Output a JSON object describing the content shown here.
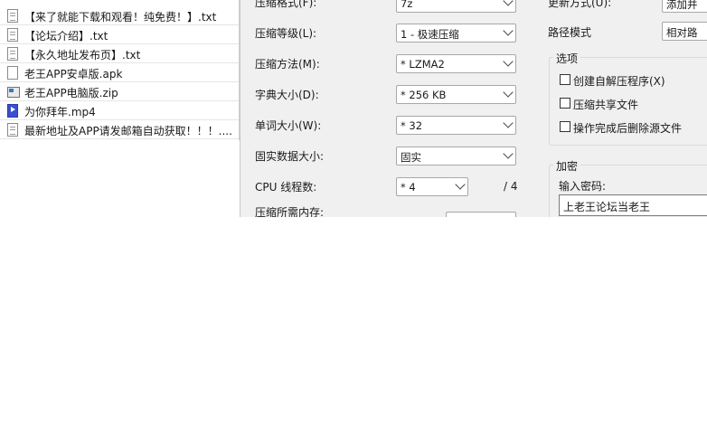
{
  "file_list": [
    {
      "icon": "text-file-icon",
      "name": "【来了就能下载和观看！纯免费！】.txt"
    },
    {
      "icon": "text-file-icon",
      "name": "【论坛介绍】.txt"
    },
    {
      "icon": "text-file-icon",
      "name": "【永久地址发布页】.txt"
    },
    {
      "icon": "file-icon",
      "name": "老王APP安卓版.apk"
    },
    {
      "icon": "archive-file-icon",
      "name": "老王APP电脑版.zip"
    },
    {
      "icon": "video-file-icon",
      "name": "为你拜年.mp4"
    },
    {
      "icon": "text-file-icon",
      "name": "最新地址及APP请发邮箱自动获取！！！...."
    }
  ],
  "dialog": {
    "format_label": "压缩格式(F):",
    "format_value": "7z",
    "level_label": "压缩等级(L):",
    "level_value": "1 - 极速压缩",
    "method_label": "压缩方法(M):",
    "method_value": "* LZMA2",
    "dict_label": "字典大小(D):",
    "dict_value": "* 256 KB",
    "word_label": "单词大小(W):",
    "word_value": "* 32",
    "solid_label": "固实数据大小:",
    "solid_value": "固实",
    "threads_label": "CPU 线程数:",
    "threads_value": "* 4",
    "threads_total": "/ 4",
    "memory_label": "压缩所需内存:",
    "update_label": "更新方式(U):",
    "update_value": "添加并",
    "path_label": "路径模式",
    "path_value": "相对路",
    "options_title": "选项",
    "options": [
      {
        "label": "创建自解压程序(X)",
        "checked": false
      },
      {
        "label": "压缩共享文件",
        "checked": false
      },
      {
        "label": "操作完成后删除源文件",
        "checked": false
      }
    ],
    "encryption_title": "加密",
    "password_label": "输入密码:",
    "password_value": "上老王论坛当老王"
  }
}
